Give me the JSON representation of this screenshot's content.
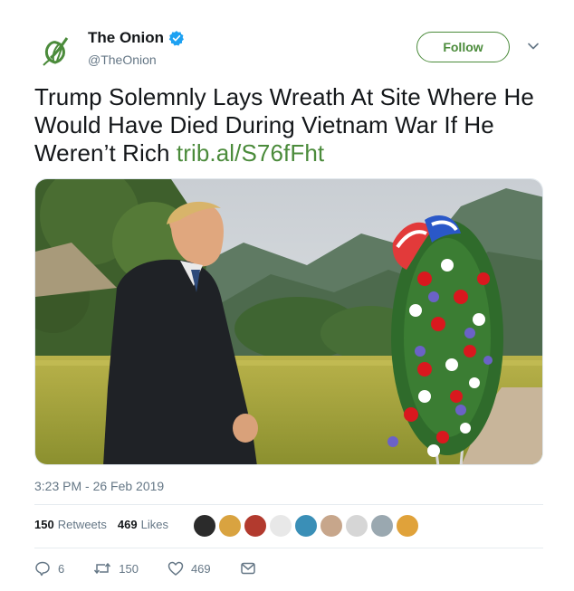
{
  "account": {
    "display_name": "The Onion",
    "handle": "@TheOnion",
    "verified": true,
    "avatar_icon": "onion-logo-icon",
    "brand_color": "#4b8b3b"
  },
  "follow_button": {
    "label": "Follow"
  },
  "menu": {
    "icon": "chevron-down-icon"
  },
  "tweet": {
    "text": "Trump Solemnly Lays Wreath At Site Where He Would Have Died During Vietnam War If He Weren’t Rich ",
    "link": "trib.al/S76fFht",
    "link_color": "#4b8b3b"
  },
  "media": {
    "icon": "photo-image"
  },
  "timestamp": "3:23 PM - 26 Feb 2019",
  "stats": {
    "retweets_count": "150",
    "retweets_label": "Retweets",
    "likes_count": "469",
    "likes_label": "Likes",
    "liker_avatar_colors": [
      "#2b2b2b",
      "#d9a340",
      "#b23a2e",
      "#e8e8e8",
      "#3a8fb7",
      "#c7a68b",
      "#d6d6d6",
      "#9aa8b0",
      "#e0a23a"
    ]
  },
  "actions": {
    "reply_count": "6",
    "retweet_count": "150",
    "like_count": "469",
    "reply_icon": "reply-icon",
    "retweet_icon": "retweet-icon",
    "like_icon": "heart-icon",
    "dm_icon": "envelope-icon"
  }
}
